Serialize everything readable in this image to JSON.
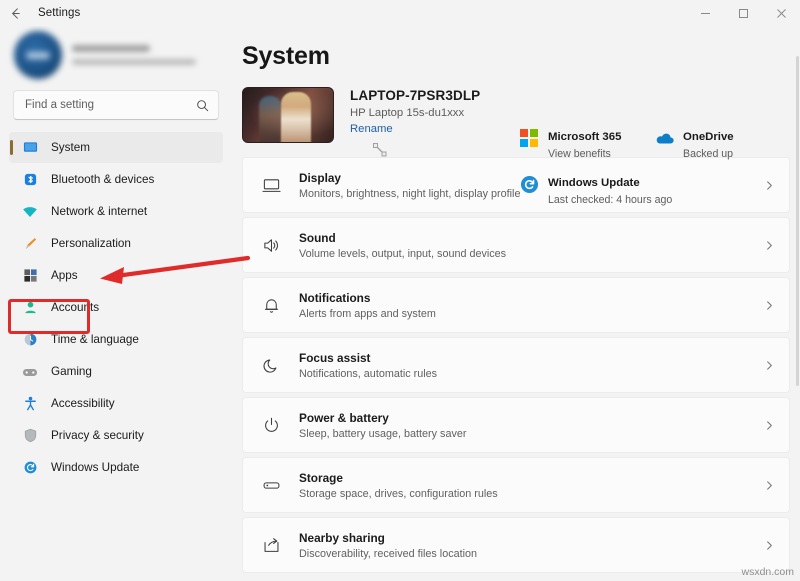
{
  "window": {
    "title": "Settings",
    "back_icon": "back-arrow-icon",
    "controls": {
      "minimize": "─",
      "maximize": "☐",
      "close": "✕"
    }
  },
  "sidebar": {
    "account": {
      "name_blurred": "",
      "email_blurred": ""
    },
    "search": {
      "placeholder": "Find a setting",
      "value": "",
      "icon": "search-icon"
    },
    "items": [
      {
        "label": "System",
        "icon": "monitor-icon",
        "color": "#1f7fd4",
        "active": true
      },
      {
        "label": "Bluetooth & devices",
        "icon": "bluetooth-icon",
        "color": "#1a7fe0",
        "active": false
      },
      {
        "label": "Network & internet",
        "icon": "wifi-icon",
        "color": "#14b6c4",
        "active": false
      },
      {
        "label": "Personalization",
        "icon": "paintbrush-icon",
        "color": "#e8912a",
        "active": false
      },
      {
        "label": "Apps",
        "icon": "apps-grid-icon",
        "color": "#474747",
        "active": false
      },
      {
        "label": "Accounts",
        "icon": "person-icon",
        "color": "#1fb88c",
        "active": false
      },
      {
        "label": "Time & language",
        "icon": "clock-globe-icon",
        "color": "#2b7fc8",
        "active": false
      },
      {
        "label": "Gaming",
        "icon": "gamepad-icon",
        "color": "#9a9a9a",
        "active": false
      },
      {
        "label": "Accessibility",
        "icon": "accessibility-person-icon",
        "color": "#1f7fd4",
        "active": false
      },
      {
        "label": "Privacy & security",
        "icon": "shield-icon",
        "color": "#9b9b9b",
        "active": false
      },
      {
        "label": "Windows Update",
        "icon": "update-sync-icon",
        "color": "#1f8ed4",
        "active": false
      }
    ]
  },
  "main": {
    "page_title": "System",
    "device": {
      "name": "LAPTOP-7PSR3DLP",
      "model": "HP Laptop 15s-du1xxx",
      "rename_label": "Rename",
      "thumbnail": "device-wallpaper-thumbnail"
    },
    "status_cards": [
      {
        "title": "Microsoft 365",
        "subtitle": "View benefits",
        "icon": "microsoft-365-logo-icon"
      },
      {
        "title": "OneDrive",
        "subtitle": "Backed up",
        "icon": "onedrive-cloud-icon"
      },
      {
        "title": "Windows Update",
        "subtitle": "Last checked: 4 hours ago",
        "icon": "update-sync-icon"
      }
    ],
    "settings_rows": [
      {
        "title": "Display",
        "subtitle": "Monitors, brightness, night light, display profile",
        "icon": "display-monitor-icon"
      },
      {
        "title": "Sound",
        "subtitle": "Volume levels, output, input, sound devices",
        "icon": "speaker-icon"
      },
      {
        "title": "Notifications",
        "subtitle": "Alerts from apps and system",
        "icon": "bell-icon"
      },
      {
        "title": "Focus assist",
        "subtitle": "Notifications, automatic rules",
        "icon": "moon-icon"
      },
      {
        "title": "Power & battery",
        "subtitle": "Sleep, battery usage, battery saver",
        "icon": "power-icon"
      },
      {
        "title": "Storage",
        "subtitle": "Storage space, drives, configuration rules",
        "icon": "drive-icon"
      },
      {
        "title": "Nearby sharing",
        "subtitle": "Discoverability, received files location",
        "icon": "share-icon"
      }
    ],
    "chevron": "›"
  },
  "annotation": {
    "highlight_target": "Apps",
    "color": "#e02b2b"
  },
  "watermark": "wsxdn.com"
}
